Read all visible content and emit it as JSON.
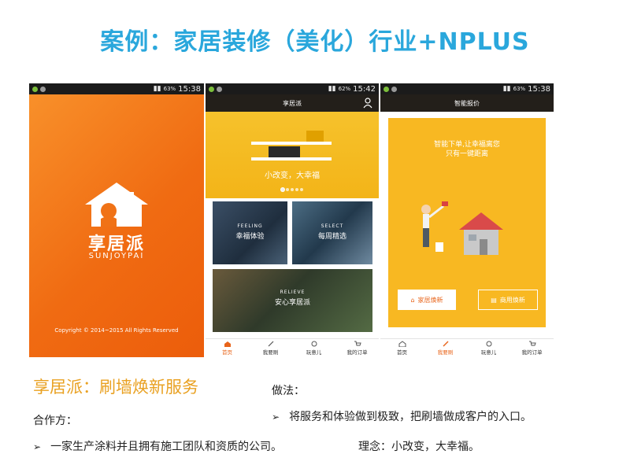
{
  "slide_title": "案例：家居装修（美化）行业+NPLUS",
  "phones": {
    "splash": {
      "status_time": "15:38",
      "status_battery": "63%",
      "brand_cn": "享居派",
      "brand_en": "SUNJOYPAI",
      "copyright": "Copyright © 2014~2015 All Rights Reserved"
    },
    "home": {
      "status_time": "15:42",
      "status_battery": "62%",
      "app_title": "享居派",
      "banner_text": "小改变，大幸福",
      "tiles": [
        {
          "tag": "FEELING",
          "name": "幸福体验"
        },
        {
          "tag": "SELECT",
          "name": "每周精选"
        },
        {
          "tag": "RELIEVE",
          "name": "安心享居派"
        }
      ],
      "tabs": [
        "首页",
        "我要刷",
        "玩意儿",
        "我的订单"
      ]
    },
    "quote": {
      "status_time": "15:38",
      "status_battery": "63%",
      "app_title": "智能报价",
      "card_line1": "智能下单,让幸福离您",
      "card_line2": "只有一键距离",
      "btn_home": "家居焕新",
      "btn_commercial": "商用焕新",
      "tabs": [
        "首页",
        "我要刷",
        "玩意儿",
        "我的订单"
      ]
    }
  },
  "section": {
    "brand": "享居派",
    "sep": "：",
    "service": "刷墙焕新服务"
  },
  "partner": {
    "label": "合作方：",
    "arrow": "➢",
    "text": "一家生产涂料并且拥有施工团队和资质的公司。"
  },
  "method": {
    "label": "做法：",
    "arrow": "➢",
    "text": "将服务和体验做到极致，把刷墙做成客户的入口。"
  },
  "concept": "理念：小改变，大幸福。",
  "colors": {
    "title_blue": "#2aa7dc",
    "accent_orange": "#e8641a",
    "section_gold": "#e9a122"
  }
}
